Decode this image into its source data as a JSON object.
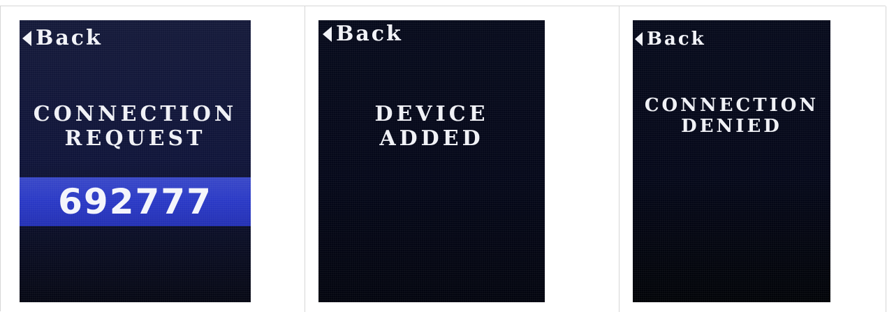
{
  "panels": [
    {
      "back_label": "Back",
      "title_lines": [
        "CONNECTION",
        "REQUEST"
      ],
      "code": "692777"
    },
    {
      "back_label": "Back",
      "title_lines": [
        "DEVICE",
        "ADDED"
      ]
    },
    {
      "back_label": "Back",
      "title_lines": [
        "CONNECTION",
        "DENIED"
      ]
    }
  ],
  "colors": {
    "screen_background": "#07091a",
    "highlight_band": "#2a39c6",
    "text": "#f0f1f6",
    "table_border": "#d6d6d6"
  },
  "icons": {
    "back": "left-triangle-icon"
  }
}
